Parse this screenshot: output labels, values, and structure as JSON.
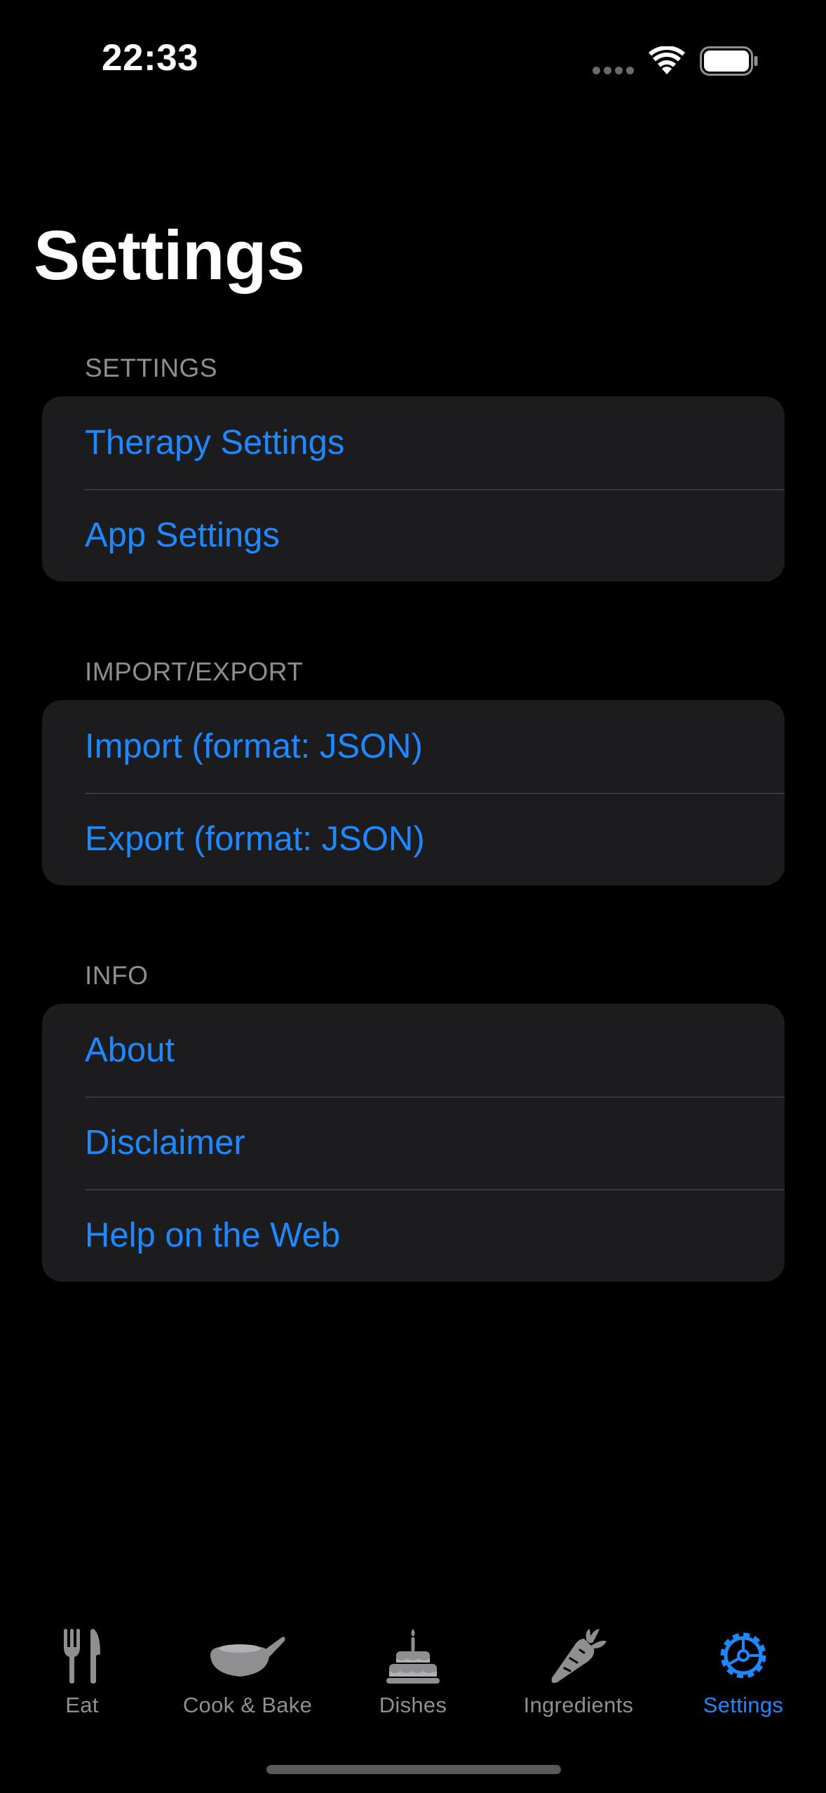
{
  "status_bar": {
    "time": "22:33",
    "signal_icon": "cellular-dots-icon",
    "wifi_icon": "wifi-icon",
    "battery_icon": "battery-icon"
  },
  "page": {
    "title": "Settings"
  },
  "sections": [
    {
      "header": "SETTINGS",
      "items": [
        "Therapy Settings",
        "App Settings"
      ]
    },
    {
      "header": "IMPORT/EXPORT",
      "items": [
        "Import (format: JSON)",
        "Export (format: JSON)"
      ]
    },
    {
      "header": "INFO",
      "items": [
        "About",
        "Disclaimer",
        "Help on the Web"
      ]
    }
  ],
  "tab_bar": {
    "tabs": [
      {
        "label": "Eat",
        "icon": "fork-knife-icon",
        "selected": false
      },
      {
        "label": "Cook & Bake",
        "icon": "frying-pan-icon",
        "selected": false
      },
      {
        "label": "Dishes",
        "icon": "birthday-cake-icon",
        "selected": false
      },
      {
        "label": "Ingredients",
        "icon": "carrot-icon",
        "selected": false
      },
      {
        "label": "Settings",
        "icon": "gear-icon",
        "selected": true
      }
    ]
  },
  "colors": {
    "background": "#000000",
    "group_background": "#1c1c1e",
    "accent": "#1e88ff",
    "secondary_text": "#8d8d93",
    "inactive_tab": "#8e8e93"
  }
}
